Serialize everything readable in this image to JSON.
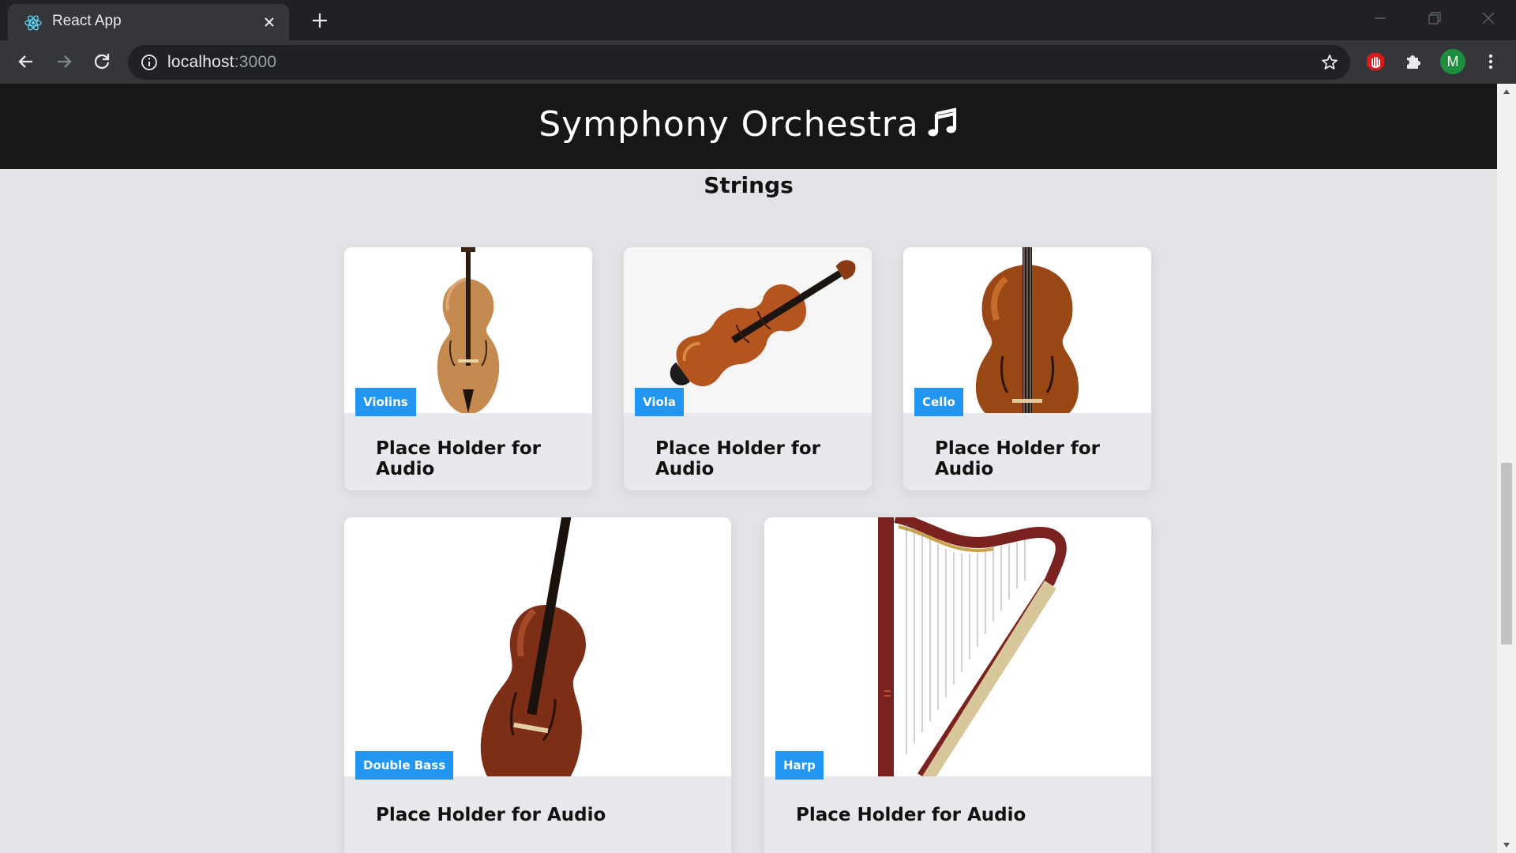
{
  "browser": {
    "tab_title": "React App",
    "url_host": "localhost",
    "url_port": ":3000",
    "profile_initial": "M"
  },
  "page": {
    "site_title": "Symphony Orchestra",
    "section_title": "Strings",
    "accent_color": "#2196f3",
    "header_bg": "#181717"
  },
  "cards": [
    {
      "label": "Violins",
      "caption": "Place Holder for Audio"
    },
    {
      "label": "Viola",
      "caption": "Place Holder for Audio"
    },
    {
      "label": "Cello",
      "caption": "Place Holder for Audio"
    },
    {
      "label": "Double Bass",
      "caption": "Place Holder for Audio"
    },
    {
      "label": "Harp",
      "caption": "Place Holder for Audio"
    }
  ],
  "icons": [
    "react-icon",
    "close-icon",
    "plus-icon",
    "minimize-icon",
    "restore-icon",
    "window-close-icon",
    "back-icon",
    "forward-icon",
    "reload-icon",
    "info-icon",
    "star-icon",
    "stop-extension-icon",
    "puzzle-icon",
    "menu-icon",
    "music-note-icon"
  ]
}
